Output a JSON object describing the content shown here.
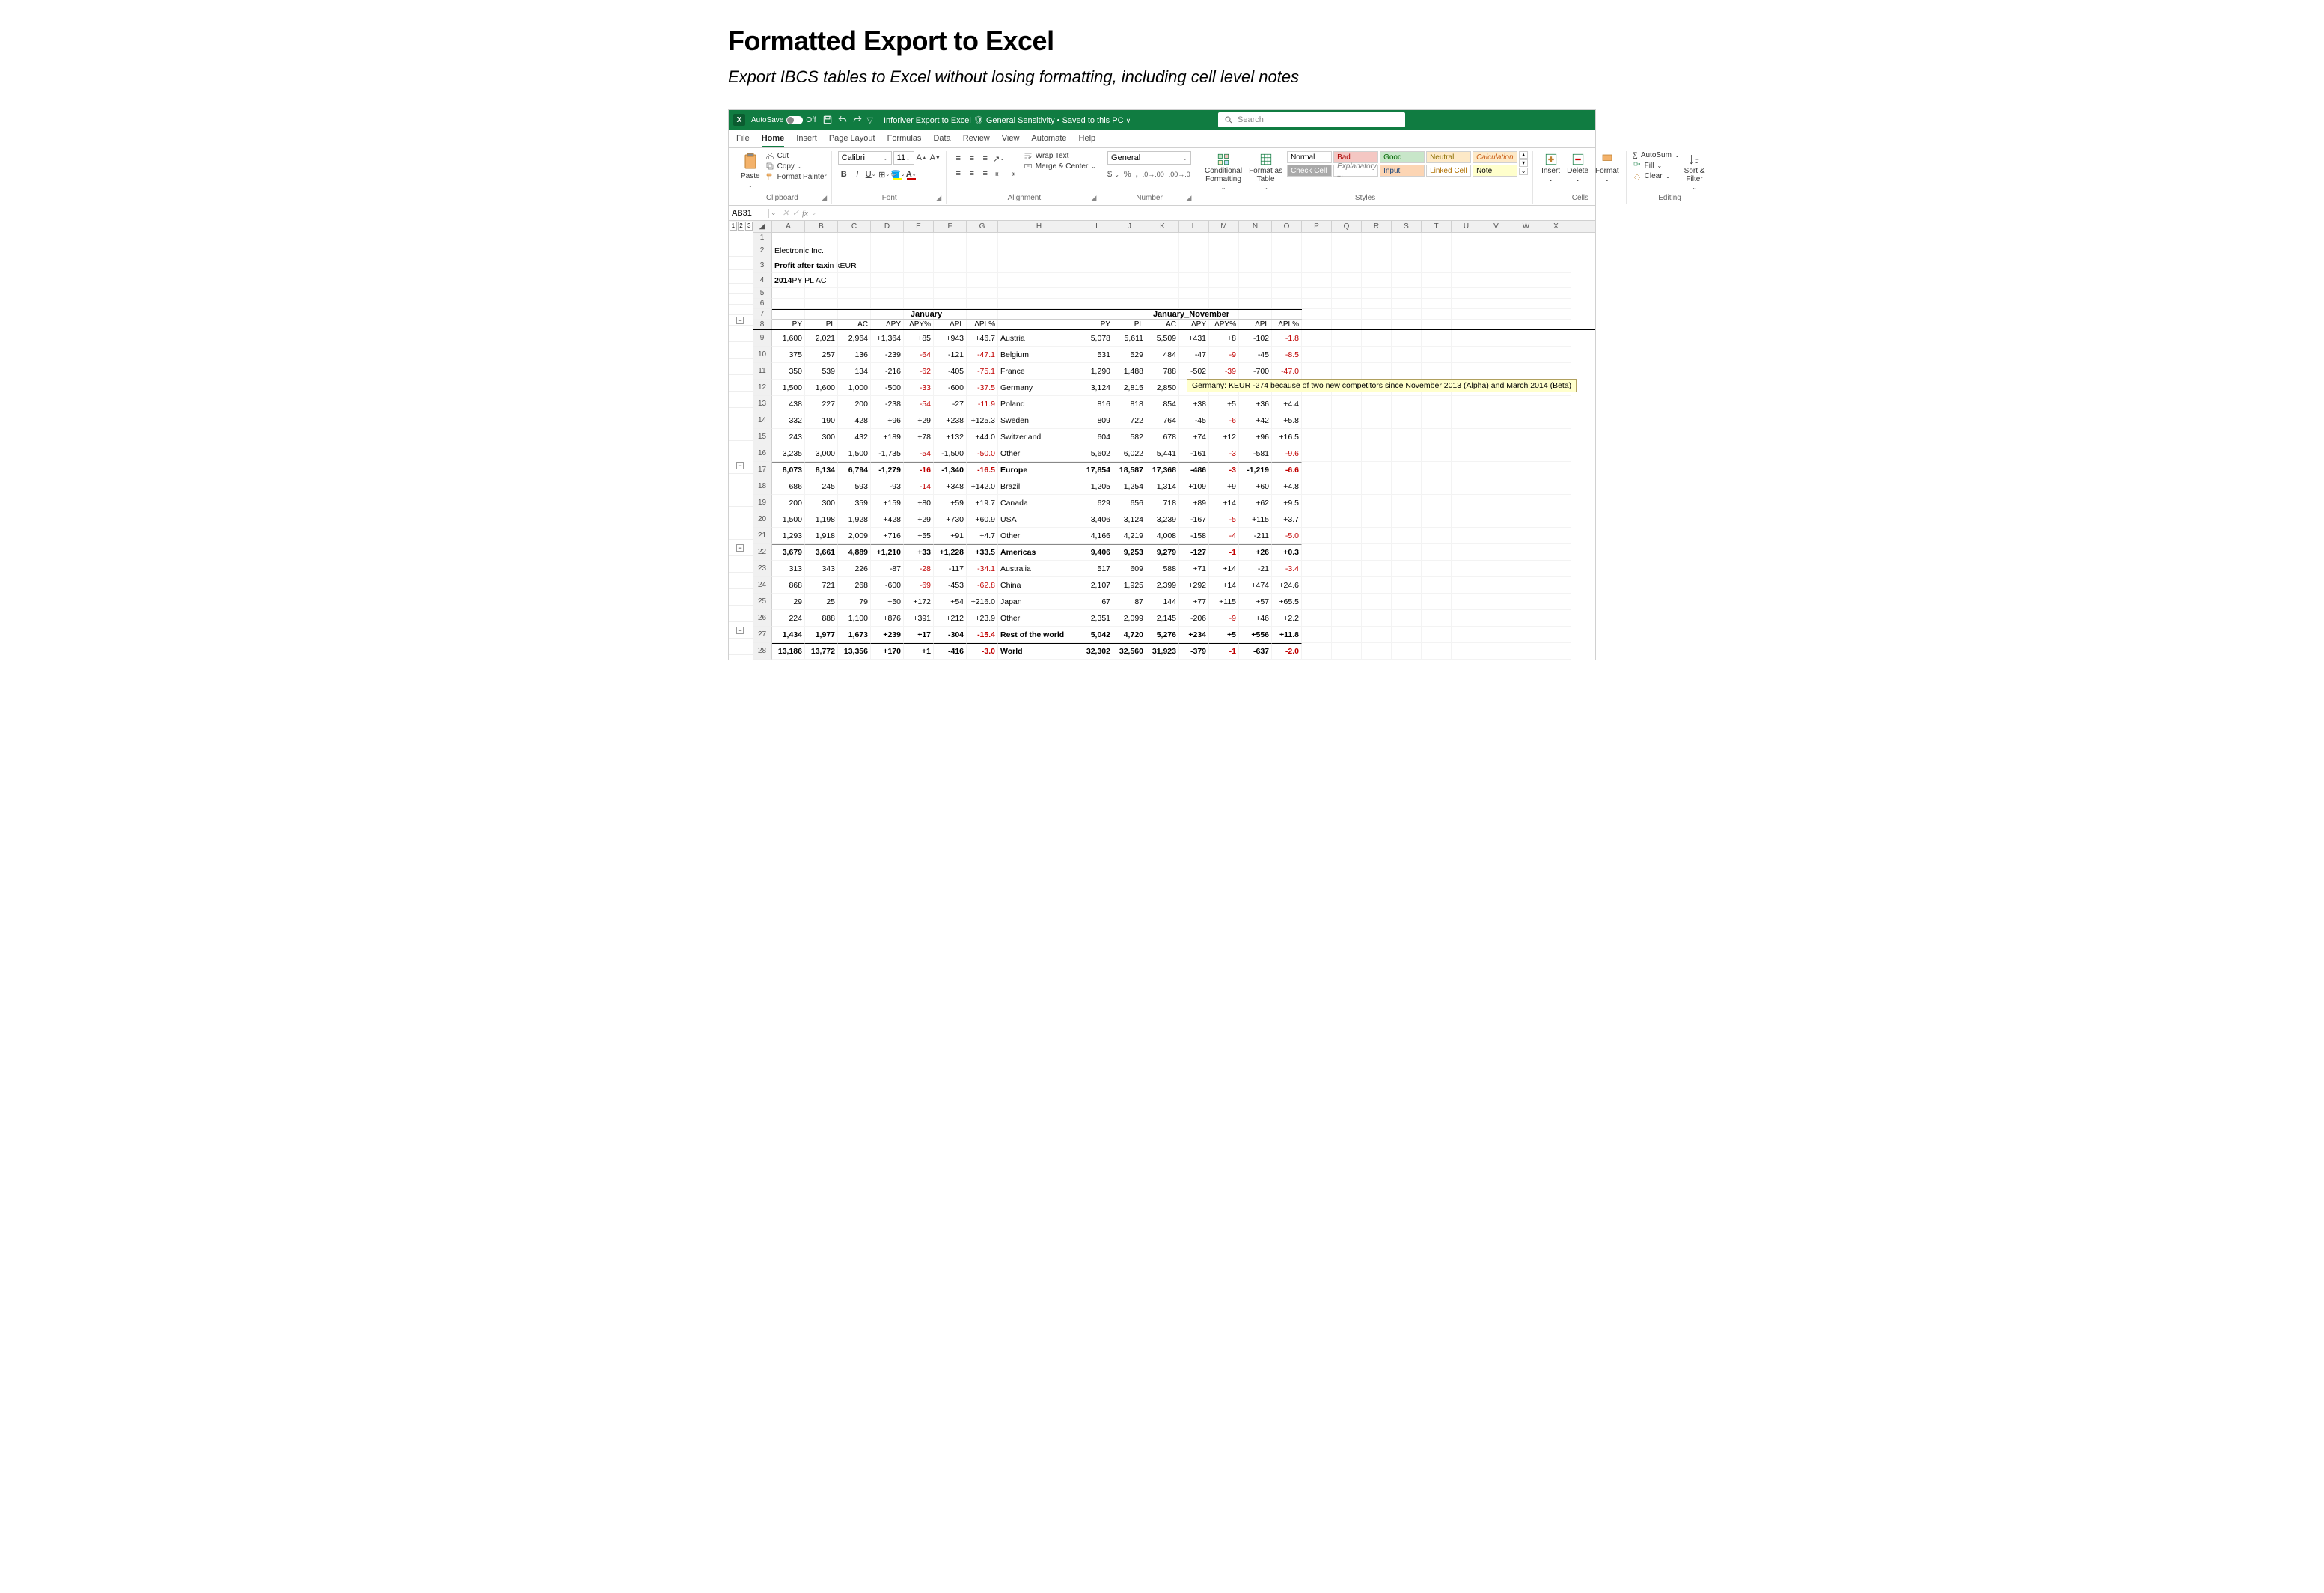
{
  "page": {
    "title": "Formatted Export to Excel",
    "subtitle": "Export IBCS tables to Excel without losing formatting, including cell level notes"
  },
  "titlebar": {
    "autosave_label": "AutoSave",
    "autosave_state": "Off",
    "doc_title": "Inforiver Export to Excel",
    "sensitivity": "General Sensitivity",
    "saved_state": "Saved to this PC",
    "search_placeholder": "Search"
  },
  "tabs": [
    "File",
    "Home",
    "Insert",
    "Page Layout",
    "Formulas",
    "Data",
    "Review",
    "View",
    "Automate",
    "Help"
  ],
  "active_tab": "Home",
  "ribbon": {
    "clipboard": {
      "paste": "Paste",
      "cut": "Cut",
      "copy": "Copy",
      "painter": "Format Painter",
      "label": "Clipboard"
    },
    "font": {
      "name": "Calibri",
      "size": "11",
      "label": "Font"
    },
    "alignment": {
      "wrap": "Wrap Text",
      "merge": "Merge & Center",
      "label": "Alignment"
    },
    "number": {
      "format": "General",
      "label": "Number"
    },
    "styles": {
      "cond": "Conditional\nFormatting",
      "fmttable": "Format as\nTable",
      "cells": [
        "Normal",
        "Bad",
        "Good",
        "Neutral",
        "Calculation",
        "Check Cell",
        "Explanatory ...",
        "Input",
        "Linked Cell",
        "Note"
      ],
      "label": "Styles"
    },
    "cells": {
      "insert": "Insert",
      "delete": "Delete",
      "format": "Format",
      "label": "Cells"
    },
    "editing": {
      "sum": "AutoSum",
      "fill": "Fill",
      "clear": "Clear",
      "sort": "Sort &\nFilter",
      "label": "Editing"
    }
  },
  "name_box": "AB31",
  "columns_letters": [
    "A",
    "B",
    "C",
    "D",
    "E",
    "F",
    "G",
    "H",
    "I",
    "J",
    "K",
    "L",
    "M",
    "N",
    "O",
    "P",
    "Q",
    "R",
    "S",
    "T",
    "U",
    "V",
    "W",
    "X"
  ],
  "meta": {
    "company": "Electronic Inc.,",
    "measure_prefix": "Profit after tax",
    "measure_unit": " in kEUR",
    "scenario_line_bold": "2014",
    "scenario_line_rest": " PY PL AC"
  },
  "periods": {
    "jan": "January",
    "ytd": "January_November"
  },
  "col_headers": [
    "PY",
    "PL",
    "AC",
    "ΔPY",
    "ΔPY%",
    "ΔPL",
    "ΔPL%",
    "",
    "PY",
    "PL",
    "AC",
    "ΔPY",
    "ΔPY%",
    "ΔPL",
    "ΔPL%"
  ],
  "rows": [
    {
      "r": 9,
      "lbl": "Austria",
      "jan": [
        "1,600",
        "2,021",
        "2,964",
        "+1,364",
        "+85",
        "+943",
        "+46.7"
      ],
      "ytd": [
        "5,078",
        "5,611",
        "5,509",
        "+431",
        "+8",
        "-102",
        "-1.8"
      ]
    },
    {
      "r": 10,
      "lbl": "Belgium",
      "jan": [
        "375",
        "257",
        "136",
        "-239",
        "-64",
        "-121",
        "-47.1"
      ],
      "ytd": [
        "531",
        "529",
        "484",
        "-47",
        "-9",
        "-45",
        "-8.5"
      ]
    },
    {
      "r": 11,
      "lbl": "France",
      "jan": [
        "350",
        "539",
        "134",
        "-216",
        "-62",
        "-405",
        "-75.1"
      ],
      "ytd": [
        "1,290",
        "1,488",
        "788",
        "-502",
        "-39",
        "-700",
        "-47.0"
      ]
    },
    {
      "r": 12,
      "lbl": "Germany",
      "jan": [
        "1,500",
        "1,600",
        "1,000",
        "-500",
        "-33",
        "-600",
        "-37.5"
      ],
      "ytd": [
        "3,124",
        "2,815",
        "2,850",
        "-274",
        "",
        "",
        ""
      ],
      "note": "Germany: KEUR -274 because of two new competitors since November 2013 (Alpha) and March 2014 (Beta)"
    },
    {
      "r": 13,
      "lbl": "Poland",
      "jan": [
        "438",
        "227",
        "200",
        "-238",
        "-54",
        "-27",
        "-11.9"
      ],
      "ytd": [
        "816",
        "818",
        "854",
        "+38",
        "+5",
        "+36",
        "+4.4"
      ]
    },
    {
      "r": 14,
      "lbl": "Sweden",
      "jan": [
        "332",
        "190",
        "428",
        "+96",
        "+29",
        "+238",
        "+125.3"
      ],
      "ytd": [
        "809",
        "722",
        "764",
        "-45",
        "-6",
        "+42",
        "+5.8"
      ]
    },
    {
      "r": 15,
      "lbl": "Switzerland",
      "jan": [
        "243",
        "300",
        "432",
        "+189",
        "+78",
        "+132",
        "+44.0"
      ],
      "ytd": [
        "604",
        "582",
        "678",
        "+74",
        "+12",
        "+96",
        "+16.5"
      ]
    },
    {
      "r": 16,
      "lbl": "Other",
      "jan": [
        "3,235",
        "3,000",
        "1,500",
        "-1,735",
        "-54",
        "-1,500",
        "-50.0"
      ],
      "ytd": [
        "5,602",
        "6,022",
        "5,441",
        "-161",
        "-3",
        "-581",
        "-9.6"
      ]
    },
    {
      "r": 17,
      "lbl": "Europe",
      "bold": true,
      "jan": [
        "8,073",
        "8,134",
        "6,794",
        "-1,279",
        "-16",
        "-1,340",
        "-16.5"
      ],
      "ytd": [
        "17,854",
        "18,587",
        "17,368",
        "-486",
        "-3",
        "-1,219",
        "-6.6"
      ]
    },
    {
      "r": 18,
      "lbl": "Brazil",
      "jan": [
        "686",
        "245",
        "593",
        "-93",
        "-14",
        "+348",
        "+142.0"
      ],
      "ytd": [
        "1,205",
        "1,254",
        "1,314",
        "+109",
        "+9",
        "+60",
        "+4.8"
      ]
    },
    {
      "r": 19,
      "lbl": "Canada",
      "jan": [
        "200",
        "300",
        "359",
        "+159",
        "+80",
        "+59",
        "+19.7"
      ],
      "ytd": [
        "629",
        "656",
        "718",
        "+89",
        "+14",
        "+62",
        "+9.5"
      ]
    },
    {
      "r": 20,
      "lbl": "USA",
      "jan": [
        "1,500",
        "1,198",
        "1,928",
        "+428",
        "+29",
        "+730",
        "+60.9"
      ],
      "ytd": [
        "3,406",
        "3,124",
        "3,239",
        "-167",
        "-5",
        "+115",
        "+3.7"
      ]
    },
    {
      "r": 21,
      "lbl": "Other",
      "jan": [
        "1,293",
        "1,918",
        "2,009",
        "+716",
        "+55",
        "+91",
        "+4.7"
      ],
      "ytd": [
        "4,166",
        "4,219",
        "4,008",
        "-158",
        "-4",
        "-211",
        "-5.0"
      ]
    },
    {
      "r": 22,
      "lbl": "Americas",
      "bold": true,
      "jan": [
        "3,679",
        "3,661",
        "4,889",
        "+1,210",
        "+33",
        "+1,228",
        "+33.5"
      ],
      "ytd": [
        "9,406",
        "9,253",
        "9,279",
        "-127",
        "-1",
        "+26",
        "+0.3"
      ]
    },
    {
      "r": 23,
      "lbl": "Australia",
      "jan": [
        "313",
        "343",
        "226",
        "-87",
        "-28",
        "-117",
        "-34.1"
      ],
      "ytd": [
        "517",
        "609",
        "588",
        "+71",
        "+14",
        "-21",
        "-3.4"
      ]
    },
    {
      "r": 24,
      "lbl": "China",
      "jan": [
        "868",
        "721",
        "268",
        "-600",
        "-69",
        "-453",
        "-62.8"
      ],
      "ytd": [
        "2,107",
        "1,925",
        "2,399",
        "+292",
        "+14",
        "+474",
        "+24.6"
      ]
    },
    {
      "r": 25,
      "lbl": "Japan",
      "jan": [
        "29",
        "25",
        "79",
        "+50",
        "+172",
        "+54",
        "+216.0"
      ],
      "ytd": [
        "67",
        "87",
        "144",
        "+77",
        "+115",
        "+57",
        "+65.5"
      ]
    },
    {
      "r": 26,
      "lbl": "Other",
      "jan": [
        "224",
        "888",
        "1,100",
        "+876",
        "+391",
        "+212",
        "+23.9"
      ],
      "ytd": [
        "2,351",
        "2,099",
        "2,145",
        "-206",
        "-9",
        "+46",
        "+2.2"
      ]
    },
    {
      "r": 27,
      "lbl": "Rest of the world",
      "bold": true,
      "jan": [
        "1,434",
        "1,977",
        "1,673",
        "+239",
        "+17",
        "-304",
        "-15.4"
      ],
      "ytd": [
        "5,042",
        "4,720",
        "5,276",
        "+234",
        "+5",
        "+556",
        "+11.8"
      ]
    },
    {
      "r": 28,
      "lbl": "World",
      "bold": true,
      "grand": true,
      "jan": [
        "13,186",
        "13,772",
        "13,356",
        "+170",
        "+1",
        "-416",
        "-3.0"
      ],
      "ytd": [
        "32,302",
        "32,560",
        "31,923",
        "-379",
        "-1",
        "-637",
        "-2.0"
      ]
    }
  ],
  "outline_minus_at": [
    8,
    17,
    22,
    27
  ]
}
